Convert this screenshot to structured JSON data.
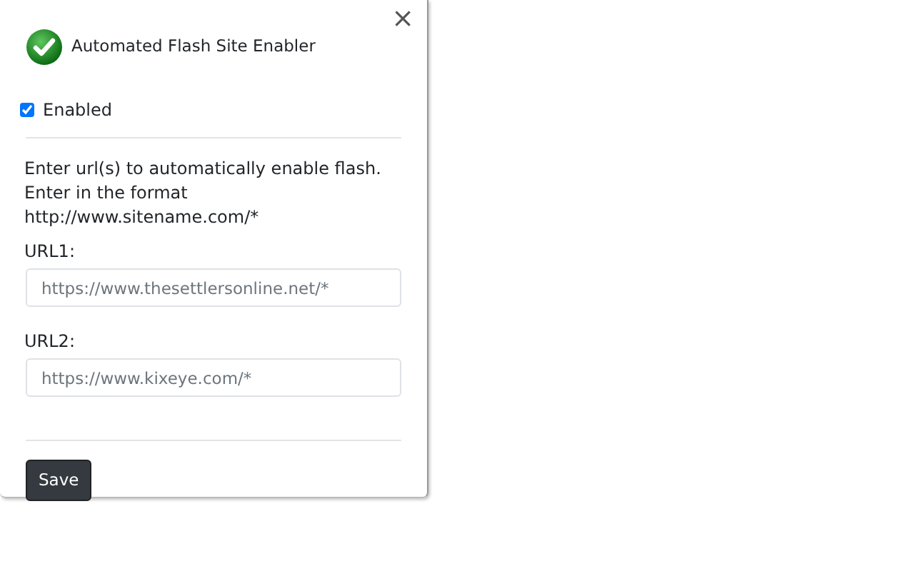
{
  "window": {
    "title": "Automated Flash Site Enabler",
    "close": "×"
  },
  "enabled": {
    "label": "Enabled",
    "checked": true
  },
  "instructions": "Enter url(s) to automatically enable flash. Enter in the format http://www.sitename.com/*",
  "urls": [
    {
      "label": "URL1:",
      "placeholder": "https://www.thesettlersonline.net/*"
    },
    {
      "label": "URL2:",
      "placeholder": "https://www.kixeye.com/*"
    }
  ],
  "buttons": [
    "Save"
  ]
}
